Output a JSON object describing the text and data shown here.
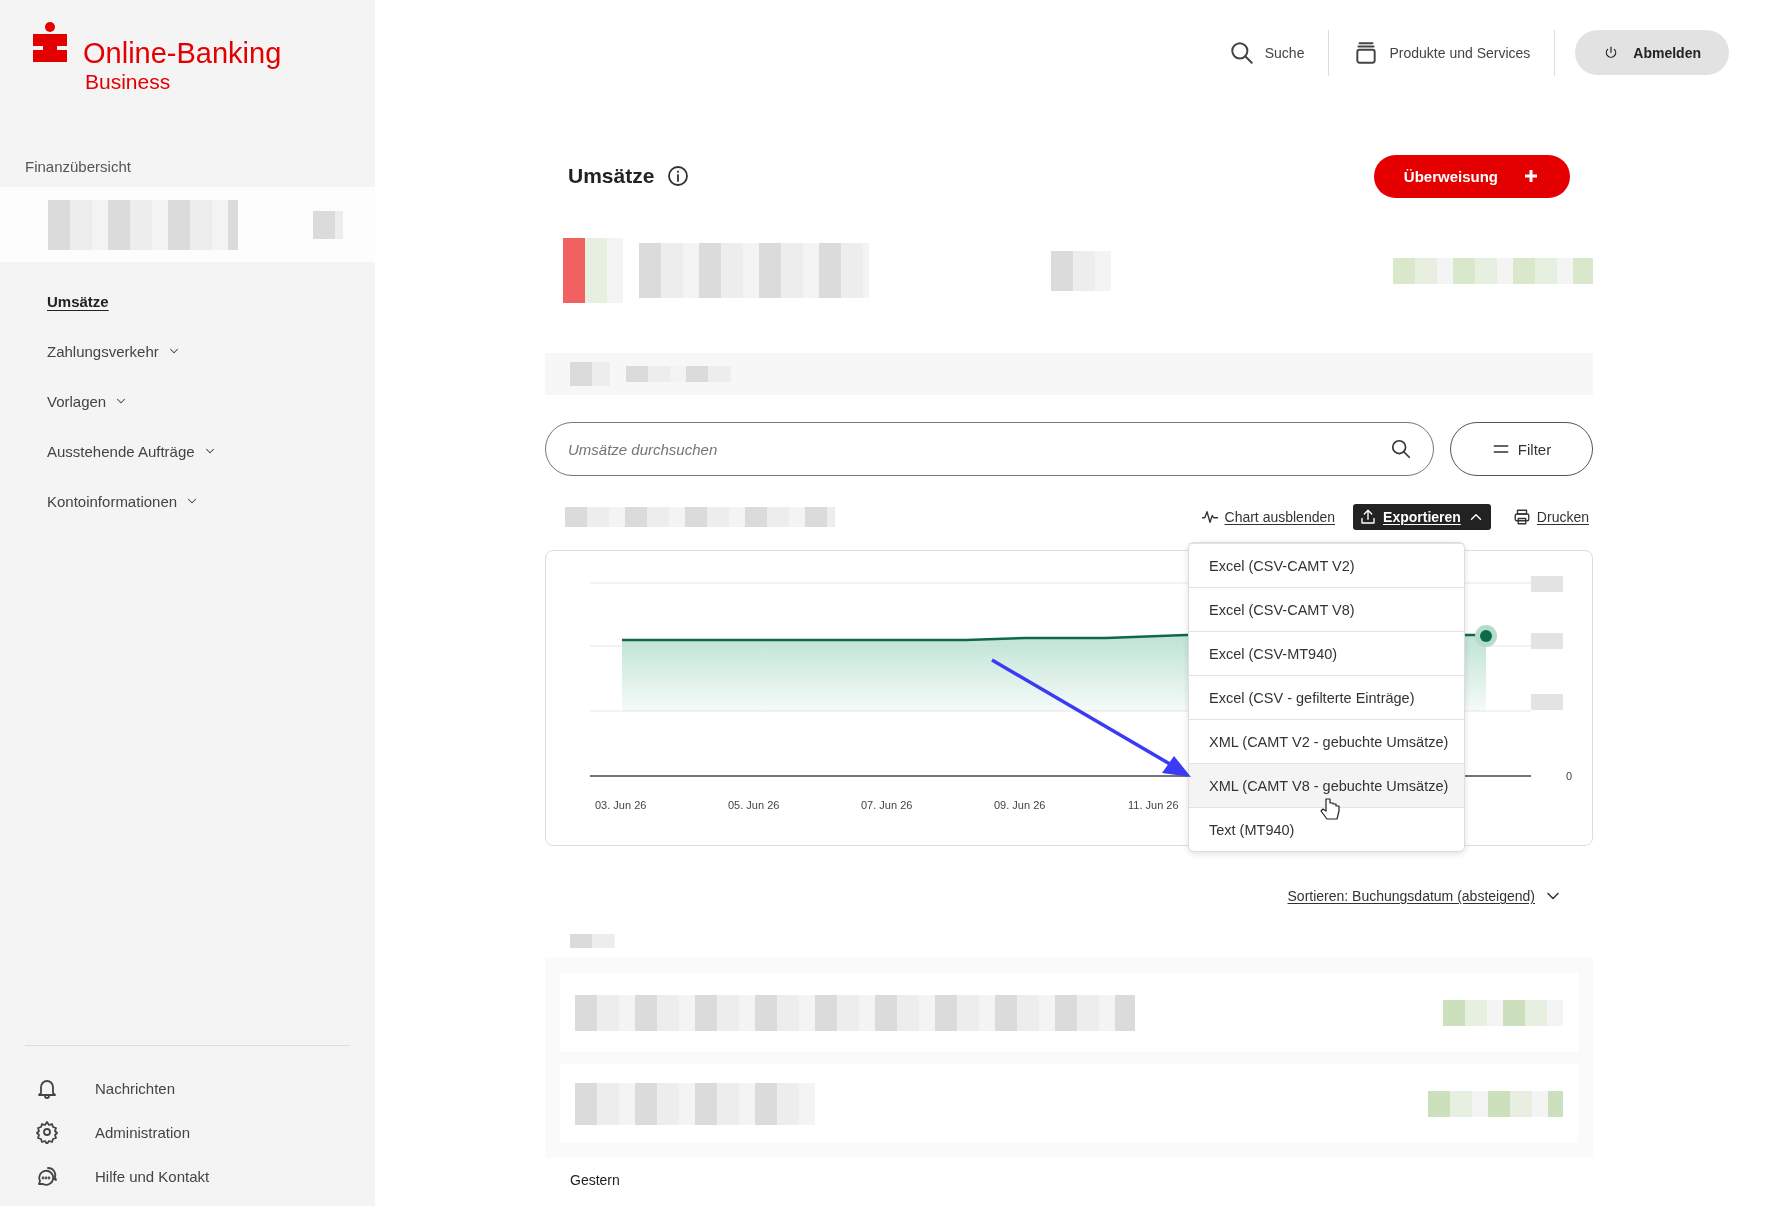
{
  "logo": {
    "title": "Online-Banking",
    "subtitle": "Business"
  },
  "header": {
    "items": [
      {
        "kind": "search",
        "label": "Suche"
      },
      {
        "kind": "products",
        "label": "Produkte und Services"
      }
    ],
    "logout": "Abmelden"
  },
  "sidebar": {
    "section": "Finanzübersicht",
    "items": [
      {
        "label": "Umsätze",
        "selected": true,
        "expandable": false
      },
      {
        "label": "Zahlungsverkehr",
        "selected": false,
        "expandable": true
      },
      {
        "label": "Vorlagen",
        "selected": false,
        "expandable": true
      },
      {
        "label": "Ausstehende Aufträge",
        "selected": false,
        "expandable": true
      },
      {
        "label": "Kontoinformationen",
        "selected": false,
        "expandable": true
      }
    ],
    "footer": [
      {
        "kind": "bell",
        "label": "Nachrichten"
      },
      {
        "kind": "gear",
        "label": "Administration"
      },
      {
        "kind": "chat",
        "label": "Hilfe und Kontakt"
      }
    ]
  },
  "page": {
    "title": "Umsätze",
    "primary_button": "Überweisung"
  },
  "search": {
    "placeholder": "Umsätze durchsuchen"
  },
  "filter_button": "Filter",
  "toolbar": {
    "chart_toggle": "Chart ausblenden",
    "export": {
      "label": "Exportieren",
      "expanded": true
    },
    "print": "Drucken"
  },
  "export_menu": [
    {
      "label": "Excel (CSV-CAMT V2)",
      "selected": false
    },
    {
      "label": "Excel (CSV-CAMT V8)",
      "selected": false
    },
    {
      "label": "Excel (CSV-MT940)",
      "selected": false
    },
    {
      "label": "Excel (CSV - gefilterte Einträge)",
      "selected": false
    },
    {
      "label": "XML (CAMT V2 - gebuchte Umsätze)",
      "selected": false
    },
    {
      "label": "XML (CAMT V8 - gebuchte Umsätze)",
      "selected": true
    },
    {
      "label": "Text (MT940)",
      "selected": false
    }
  ],
  "chart": {
    "x_labels": [
      "03. Jun 26",
      "05. Jun 26",
      "07. Jun 26",
      "09. Jun 26",
      "11. Jun 26"
    ],
    "y_label": "0"
  },
  "sort": {
    "label": "Sortieren:",
    "value": "Buchungsdatum (absteigend)"
  },
  "group_label": "Gestern"
}
